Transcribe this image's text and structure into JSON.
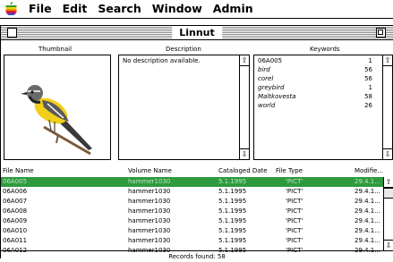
{
  "menubar": {
    "apple_icon": "apple-icon",
    "items": [
      "File",
      "Edit",
      "Search",
      "Window",
      "Admin"
    ]
  },
  "window": {
    "title": "Linnut"
  },
  "sections": {
    "thumbnail_label": "Thumbnail",
    "description_label": "Description",
    "keywords_label": "Keywords"
  },
  "description": {
    "text": "No description available."
  },
  "keywords": [
    {
      "word": "06A005",
      "count": "1"
    },
    {
      "word": "bird",
      "count": "56"
    },
    {
      "word": "corel",
      "count": "56"
    },
    {
      "word": "greybird",
      "count": "1"
    },
    {
      "word": "Maltkovesta",
      "count": "58"
    },
    {
      "word": "world",
      "count": "26"
    }
  ],
  "list": {
    "columns": [
      "File Name",
      "Volume Name",
      "Cataloged Date",
      "File Type",
      "Modifie..."
    ],
    "rows": [
      [
        "06A005",
        "hammer1030",
        "5.1.1995",
        "'PICT'",
        "29.4.1..."
      ],
      [
        "06A006",
        "hammer1030",
        "5.1.1995",
        "'PICT'",
        "29.4.1..."
      ],
      [
        "06A007",
        "hammer1030",
        "5.1.1995",
        "'PICT'",
        "29.4.1..."
      ],
      [
        "06A008",
        "hammer1030",
        "5.1.1995",
        "'PICT'",
        "29.4.1..."
      ],
      [
        "06A009",
        "hammer1030",
        "5.1.1995",
        "'PICT'",
        "29.4.1..."
      ],
      [
        "06A010",
        "hammer1030",
        "5.1.1995",
        "'PICT'",
        "29.4.1..."
      ],
      [
        "06A011",
        "hammer1030",
        "5.1.1995",
        "'PICT'",
        "29.4.1..."
      ],
      [
        "06A012",
        "hammer1030",
        "5.1.1995",
        "'PICT'",
        "29.4.1..."
      ]
    ],
    "selected_index": 0
  },
  "footer": {
    "records_text": "Records found: 58"
  },
  "colors": {
    "selection": "#2e9a3e",
    "selection_text": "#bfe3c4"
  }
}
